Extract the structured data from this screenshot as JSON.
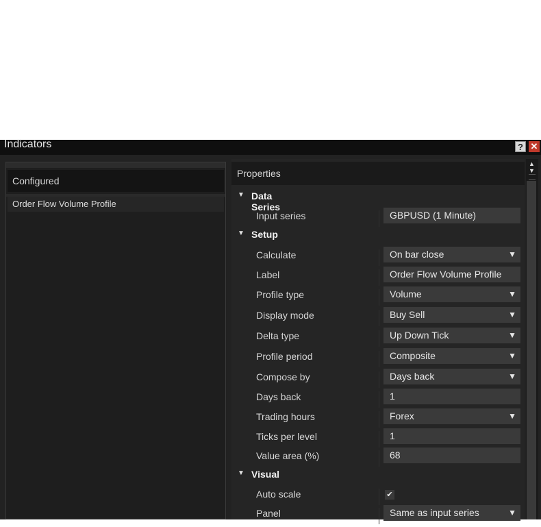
{
  "window": {
    "title": "Indicators",
    "help_label": "?",
    "close_label": "✕"
  },
  "left": {
    "header": "Configured",
    "items": [
      "Order Flow Volume Profile"
    ]
  },
  "properties": {
    "header": "Properties",
    "categories": {
      "data_series": "Data Series",
      "setup": "Setup",
      "visual": "Visual"
    },
    "rows": {
      "input_series": {
        "label": "Input series",
        "value": "GBPUSD (1 Minute)"
      },
      "calculate": {
        "label": "Calculate",
        "value": "On bar close"
      },
      "label": {
        "label": "Label",
        "value": "Order Flow Volume Profile"
      },
      "profile_type": {
        "label": "Profile type",
        "value": "Volume"
      },
      "display_mode": {
        "label": "Display mode",
        "value": "Buy Sell"
      },
      "delta_type": {
        "label": "Delta type",
        "value": "Up Down Tick"
      },
      "profile_period": {
        "label": "Profile period",
        "value": "Composite"
      },
      "compose_by": {
        "label": "Compose by",
        "value": "Days back"
      },
      "days_back": {
        "label": "Days back",
        "value": "1"
      },
      "trading_hours": {
        "label": "Trading hours",
        "value": "Forex"
      },
      "ticks_per_level": {
        "label": "Ticks per level",
        "value": "1"
      },
      "value_area": {
        "label": "Value area (%)",
        "value": "68"
      },
      "auto_scale": {
        "label": "Auto scale",
        "checked": true,
        "check_glyph": "✔"
      },
      "panel": {
        "label": "Panel",
        "value": "Same as input series"
      }
    }
  },
  "icons": {
    "collapse_arrow": "▼",
    "dropdown_chevron": "❯",
    "scroll_up": "▲",
    "scroll_down": "▼"
  }
}
